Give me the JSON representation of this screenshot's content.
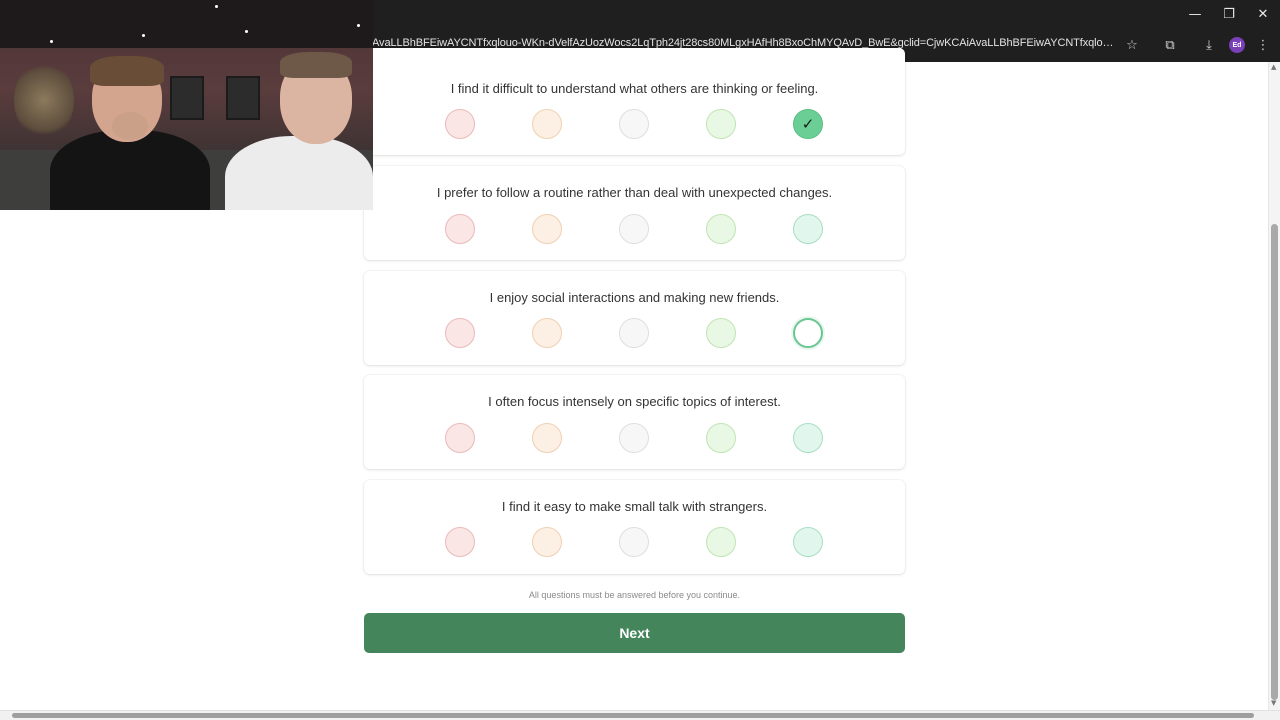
{
  "browser": {
    "url": "AvaLLBhBFEiwAYCNTfxqlouo-WKn-dVelfAzUozWocs2LqTph24jt28cs80MLgxHAfHh8BxoChMYQAvD_BwE&gclid=CjwKCAiAvaLLBhBFEiwAYCNTfxqlouo-WKn-dVel...",
    "profile_initials": "Ed",
    "controls": {
      "minimize": "—",
      "restore": "❐",
      "close": "✕"
    }
  },
  "questions": [
    {
      "text": "I find it difficult to understand what others are thinking or feeling.",
      "selected": 5
    },
    {
      "text": "I prefer to follow a routine rather than deal with unexpected changes.",
      "selected": null
    },
    {
      "text": "I enjoy social interactions and making new friends.",
      "selected": null,
      "hover": 5
    },
    {
      "text": "I often focus intensely on specific topics of interest.",
      "selected": null
    },
    {
      "text": "I find it easy to make small talk with strangers.",
      "selected": null
    }
  ],
  "footer": {
    "note": "All questions must be answered before you continue.",
    "next_label": "Next"
  },
  "colors": {
    "next_button": "#44855b",
    "selected_option": "#6bcf95"
  },
  "icons": {
    "check": "✓"
  }
}
